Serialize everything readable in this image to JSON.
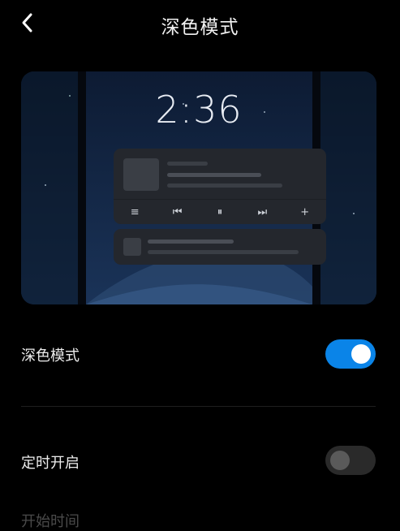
{
  "header": {
    "title": "深色模式",
    "back_icon": "chevron-left-icon"
  },
  "preview": {
    "clock": "2:36",
    "media_controls": [
      {
        "name": "playlist-icon",
        "glyph": "≡"
      },
      {
        "name": "previous-icon",
        "glyph": "⏮"
      },
      {
        "name": "pause-icon",
        "glyph": "⏸"
      },
      {
        "name": "next-icon",
        "glyph": "⏭"
      },
      {
        "name": "plus-icon",
        "glyph": "+"
      }
    ]
  },
  "settings": {
    "dark_mode": {
      "label": "深色模式",
      "enabled": true
    },
    "scheduled": {
      "label": "定时开启",
      "enabled": false
    },
    "start_time": {
      "label": "开始时间"
    }
  },
  "colors": {
    "accent": "#0a84e8",
    "background": "#000000"
  }
}
